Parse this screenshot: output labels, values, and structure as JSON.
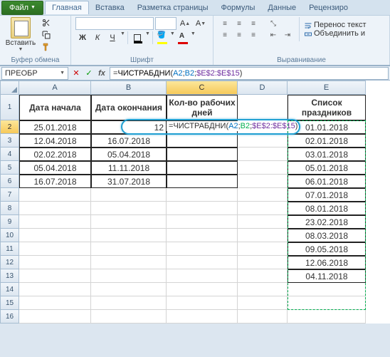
{
  "menu": {
    "file": "Файл",
    "tabs": [
      "Главная",
      "Вставка",
      "Разметка страницы",
      "Формулы",
      "Данные",
      "Рецензиро"
    ]
  },
  "ribbon": {
    "clipboard": {
      "paste": "Вставить",
      "label": "Буфер обмена"
    },
    "font": {
      "label": "Шрифт",
      "bold": "Ж",
      "italic": "К",
      "underline": "Ч"
    },
    "align": {
      "label": "Выравнивание",
      "wrap": "Перенос текст",
      "merge": "Объединить и"
    }
  },
  "name_box": "ПРЕОБР",
  "formula": {
    "eq": "=",
    "fn": "ЧИСТРАБДНИ",
    "open": "(",
    "a1": "A2",
    "sep1": ";",
    "a2": "B2",
    "sep2": ";",
    "a3": "$E$2:$E$15",
    "close": ")"
  },
  "headers": {
    "A": "Дата начала",
    "B": "Дата окончания",
    "C1": "Кол-во рабочих",
    "C2": "дней",
    "E1": "Список",
    "E2": "праздников"
  },
  "cols": [
    "A",
    "B",
    "C",
    "D",
    "E"
  ],
  "rows": [
    "1",
    "2",
    "3",
    "4",
    "5",
    "6",
    "7",
    "8",
    "9",
    "10",
    "11",
    "12",
    "13",
    "14",
    "15",
    "16"
  ],
  "data": {
    "A": [
      "25.01.2018",
      "12.04.2018",
      "02.02.2018",
      "05.04.2018",
      "16.07.2018"
    ],
    "B": [
      "12",
      "16.07.2018",
      "05.04.2018",
      "11.11.2018",
      "31.07.2018"
    ],
    "E": [
      "01.01.2018",
      "02.01.2018",
      "03.01.2018",
      "05.01.2018",
      "06.01.2018",
      "07.01.2018",
      "08.01.2018",
      "23.02.2018",
      "08.03.2018",
      "09.05.2018",
      "12.06.2018",
      "04.11.2018"
    ]
  },
  "cell_formula": "=ЧИСТРАБДНИ(A2;B2;$E$2:$E$15)"
}
